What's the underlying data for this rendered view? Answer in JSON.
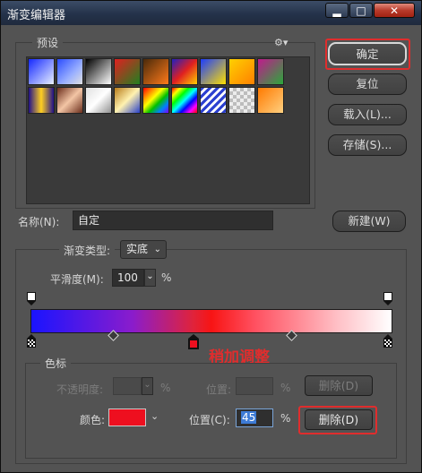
{
  "window": {
    "title": "渐变编辑器",
    "minimize_label": "▂",
    "maximize_label": "□",
    "close_label": "✕"
  },
  "buttons": {
    "ok": "确定",
    "reset": "复位",
    "load": "载入(L)...",
    "save": "存储(S)...",
    "new": "新建(W)"
  },
  "presets": {
    "label": "预设",
    "gear": "⚙▾",
    "swatches_row1": [
      "linear-gradient(135deg,#1428ff,#e8f0ff)",
      "linear-gradient(135deg,#2b4cff 0%,#9ab0ff 60%,#e0e0e0 100%)",
      "linear-gradient(135deg,#000 0%,#fff 100%)",
      "linear-gradient(135deg,#e02020 0%,#208020 100%)",
      "linear-gradient(135deg,#4a2a0a 0%,#ff7a1a 100%)",
      "linear-gradient(135deg,#2020c0 0%,#e02020 50%,#ffd000 100%)",
      "linear-gradient(135deg,#1c3cff 0%,#ffe000 100%)",
      "linear-gradient(135deg,#ffd000 0%,#ff8000 100%)",
      "linear-gradient(135deg,#c01a8c 0%,#2aa83a 100%)"
    ],
    "swatches_row2": [
      "linear-gradient(90deg,#20108a 0%,#ffcf20 50%,#20108a 100%)",
      "linear-gradient(135deg,#6b2e1c 0%,#f3c5a5 50%,#6b2e1c 100%)",
      "linear-gradient(135deg,#e0e0e0 0%,#fff 50%,#909090 100%)",
      "linear-gradient(135deg,#b87c1a 0%,#fff2b0 50%,#2840c8 100%)",
      "linear-gradient(135deg,#ff0000,#ff8000,#ffff00,#00c000,#0080ff,#8000ff)",
      "linear-gradient(135deg,#ff0000,#ffff00,#00ff00,#00ffff,#0000ff,#ff00ff,#ff0000)",
      "repeating-linear-gradient(135deg,#2b40d0 0 3px,#ffffff 3px 6px)",
      "repeating-conic-gradient(#bdbdbd 0 25%,#ececec 0 50%) 0 0/8px 8px",
      "linear-gradient(135deg,#ff7a00 0%,#ffd080 100%)"
    ]
  },
  "name": {
    "label": "名称(N):",
    "value": "自定"
  },
  "gradient": {
    "type_label": "渐变类型:",
    "type_value": "实底",
    "smooth_label": "平滑度(M):",
    "smooth_value": "100",
    "smooth_unit": "%",
    "bar": "linear-gradient(90deg,#1a14ff 0%,#8a1ccc 28%,#e0233a 45%,#f81414 50%,#ff5060 62%,#ffc0c6 85%,#ffffff 100%)",
    "annotation": "稍加调整"
  },
  "stops": {
    "label": "色标",
    "opacity_label": "不透明度:",
    "opacity_unit": "%",
    "location_top_label": "位置:",
    "location_top_unit": "%",
    "delete_top": "删除(D)",
    "color_label": "颜色:",
    "color_value": "#ee0f1f",
    "location_label": "位置(C):",
    "location_value": "45",
    "location_unit": "%",
    "delete": "删除(D)"
  },
  "accent": "#e02d2d"
}
